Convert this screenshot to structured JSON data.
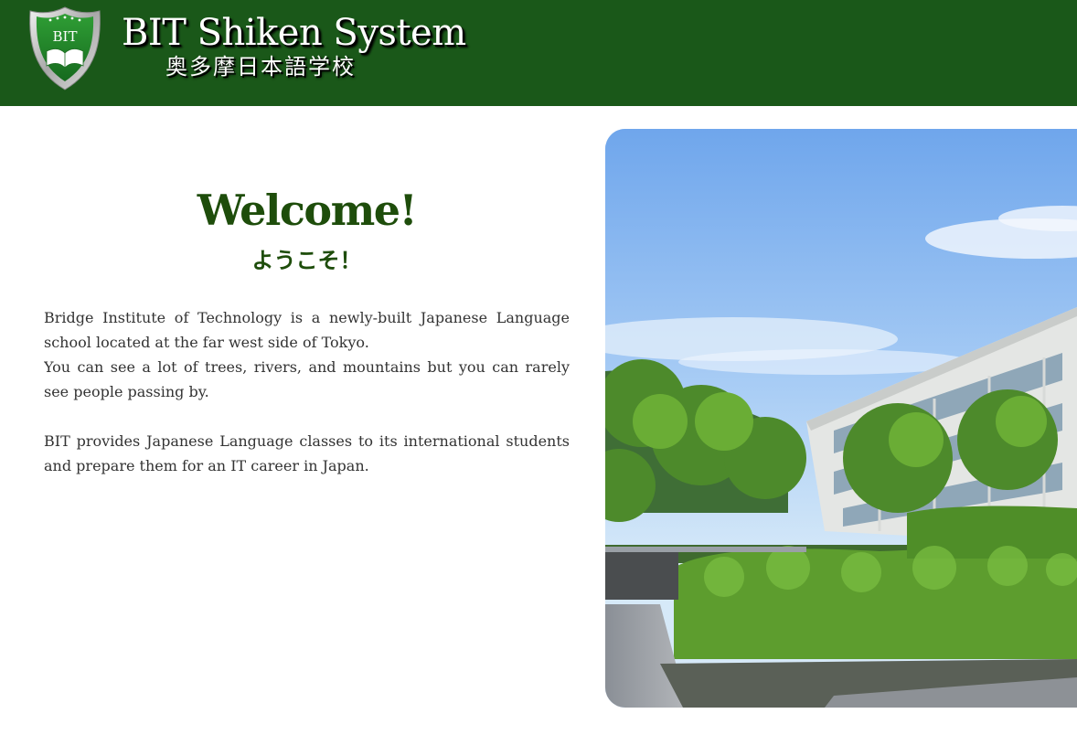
{
  "header": {
    "logo": {
      "text": "BIT",
      "small_text": "Bridge Institute of Technology"
    },
    "title": "BIT Shiken System",
    "subtitle": "奥多摩日本語学校"
  },
  "main": {
    "heading": "Welcome!",
    "heading_jp": "ようこそ！",
    "paragraphs": [
      "Bridge Institute of Technology is a newly-built Japanese Language school located at the far west side of Tokyo.",
      "You can see a lot of trees, rivers, and mountains but you can rarely see people passing by.",
      "BIT provides Japanese Language classes to its international students and prepare them for an IT career in Japan."
    ]
  },
  "colors": {
    "header_bg": "#1a5819",
    "heading": "#1e4d0b",
    "body_text": "#333333"
  }
}
